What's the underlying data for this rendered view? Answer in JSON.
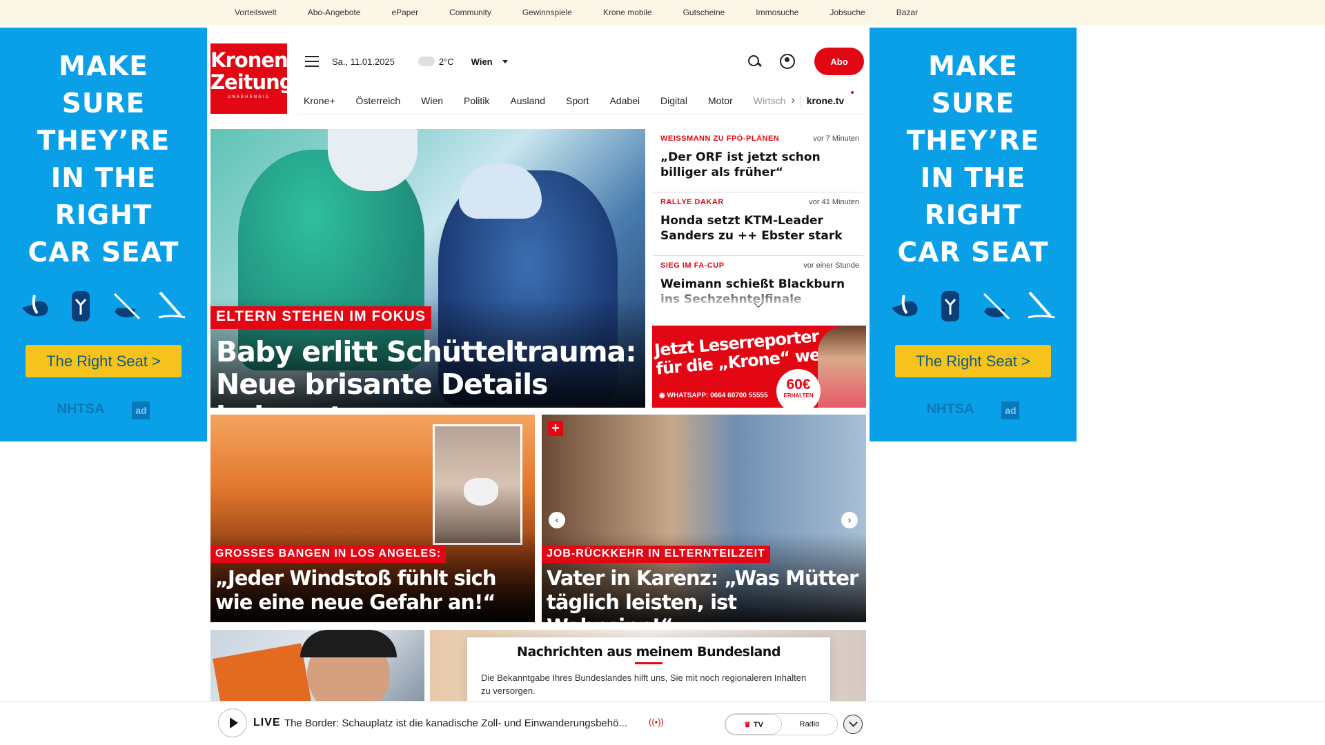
{
  "topnav": [
    "Vorteilswelt",
    "Abo-Angebote",
    "ePaper",
    "Community",
    "Gewinnspiele",
    "Krone mobile",
    "Gutscheine",
    "Immosuche",
    "Jobsuche",
    "Bazar"
  ],
  "ad": {
    "lines": [
      "MAKE",
      "SURE",
      "THEY’RE",
      "IN THE",
      "RIGHT",
      "CAR SEAT"
    ],
    "button": "The Right Seat >",
    "logo1": "NHTSA",
    "logo2": "ad",
    "bg_color": "#0aa0e8",
    "button_color": "#f5c31b"
  },
  "logo": {
    "line1": "Kronen",
    "line2": "Zeitung",
    "tagline": "UNABHÄNGIG",
    "color": "#e30613"
  },
  "header": {
    "date": "Sa., 11.01.2025",
    "temperature": "2°C",
    "city": "Wien",
    "abo_label": "Abo"
  },
  "nav": [
    "Krone+",
    "Österreich",
    "Wien",
    "Politik",
    "Ausland",
    "Sport",
    "Adabei",
    "Digital",
    "Motor",
    "Wirtsch"
  ],
  "nav_tv": "krone.tv",
  "hero": {
    "kicker": "ELTERN STEHEN IM FOKUS",
    "headline": "Baby erlitt Schütteltrauma: Neue brisante Details bekannt"
  },
  "ticker": [
    {
      "kicker": "WEISSMANN ZU FPÖ-PLÄNEN",
      "time": "vor 7 Minuten",
      "title": "„Der ORF ist jetzt schon billiger als früher“"
    },
    {
      "kicker": "RALLYE DAKAR",
      "time": "vor 41 Minuten",
      "title": "Honda setzt KTM-Leader Sanders zu ++ Ebster stark"
    },
    {
      "kicker": "SIEG IM FA-CUP",
      "time": "vor einer Stunde",
      "title": "Weimann schießt Blackburn ins Sechzehntelfinale"
    }
  ],
  "promo": {
    "line1": "Jetzt Leserreporter",
    "line2": "für die „Krone“ werden",
    "whatsapp": "WHATSAPP: 0664 60700 55555",
    "badge": "60€",
    "badge_sub": "ERHALTEN"
  },
  "cards": [
    {
      "kicker": "GROSSES BANGEN IN LOS ANGELES:",
      "headline": "„Jeder Windstoß fühlt sich wie eine neue Gefahr an!“"
    },
    {
      "kicker": "JOB-RÜCKKEHR IN ELTERNTEILZEIT",
      "headline": "Vater in Karenz: „Was Mütter täglich leisten, ist Wahnsinn!“",
      "plus": "+"
    }
  ],
  "bundesland": {
    "title": "Nachrichten aus meinem Bundesland",
    "text": "Die Bekanntgabe Ihres Bundeslandes hilft uns, Sie mit noch regionaleren Inhalten zu versorgen."
  },
  "player": {
    "live": "LIVE",
    "title": "The Border: Schauplatz ist die kanadische Zoll- und Einwanderungsbehö...",
    "tv": "TV",
    "radio": "Radio"
  }
}
